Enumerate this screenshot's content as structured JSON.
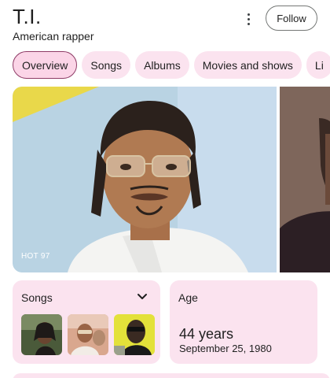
{
  "header": {
    "title": "T.I.",
    "subtitle": "American rapper",
    "follow_label": "Follow",
    "more_icon": "more-vert-icon"
  },
  "tabs": [
    {
      "label": "Overview",
      "active": true
    },
    {
      "label": "Songs",
      "active": false
    },
    {
      "label": "Albums",
      "active": false
    },
    {
      "label": "Movies and shows",
      "active": false
    },
    {
      "label": "Li",
      "active": false
    }
  ],
  "media": {
    "caption": "HOT 97"
  },
  "cards": {
    "songs": {
      "label": "Songs",
      "expand_icon": "chevron-down-icon",
      "thumbnails": [
        "song-thumb-1",
        "song-thumb-2",
        "song-thumb-3"
      ]
    },
    "age": {
      "label": "Age",
      "value": "44 years",
      "birth_date": "September 25, 1980"
    }
  },
  "colors": {
    "chip_bg": "#fbe3ef",
    "chip_active_border": "#8e3b66",
    "card_bg": "#fbe3ef"
  }
}
